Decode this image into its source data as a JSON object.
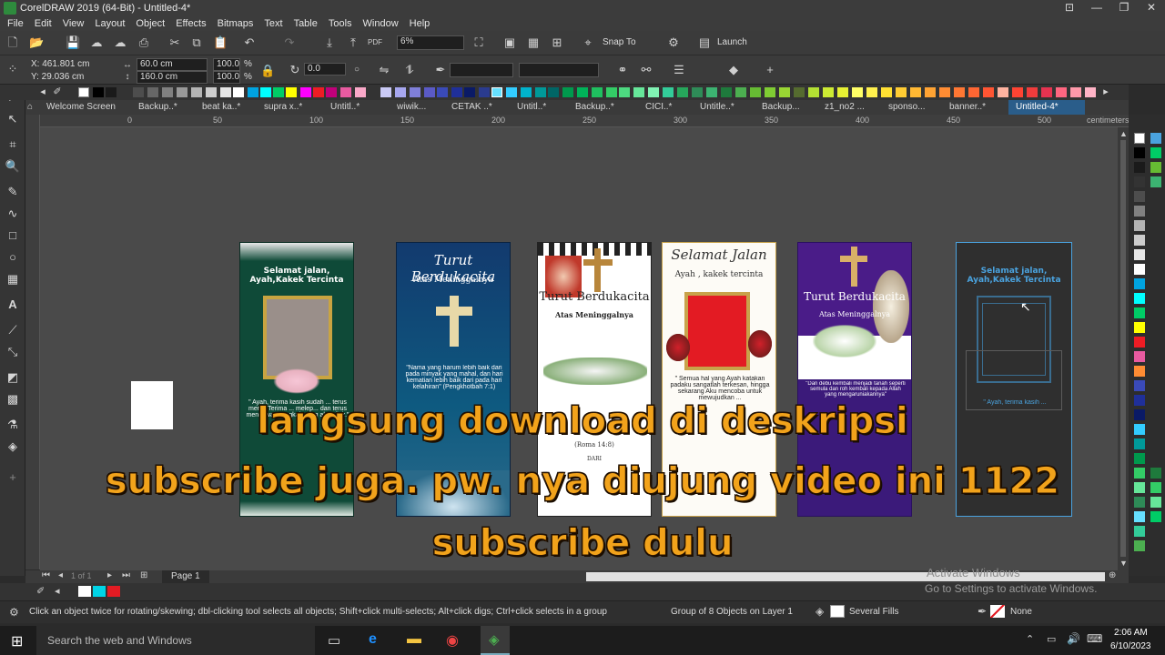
{
  "window": {
    "title": "CorelDRAW 2019 (64-Bit) - Untitled-4*",
    "controls": [
      "⊡",
      "—",
      "❐",
      "✕"
    ]
  },
  "menu": [
    "File",
    "Edit",
    "View",
    "Layout",
    "Object",
    "Effects",
    "Bitmaps",
    "Text",
    "Table",
    "Tools",
    "Window",
    "Help"
  ],
  "toolbar": {
    "zoom": "6%",
    "snap_to": "Snap To",
    "launch": "Launch"
  },
  "propertybar": {
    "x": "X: 461.801 cm",
    "y": "Y: 29.036 cm",
    "w": "60.0 cm",
    "h": "160.0 cm",
    "sx": "100.0",
    "sy": "100.0",
    "sx_unit": "%",
    "sy_unit": "%",
    "angle": "0.0"
  },
  "doc_tabs": [
    "Welcome Screen",
    "Backup..*",
    "beat ka..*",
    "supra x..*",
    "Untitl..*",
    "wiwik...",
    "CETAK ..*",
    "Untitl..*",
    "Backup..*",
    "CICI..*",
    "Untitle..*",
    "Backup...",
    "z1_no2 ...",
    "sponso...",
    "banner..*",
    "Untitled-4*"
  ],
  "ruler_unit": "centimeters",
  "ruler_h_ticks": [
    "0",
    "50",
    "100",
    "150",
    "200",
    "250",
    "300",
    "350",
    "400",
    "450",
    "500"
  ],
  "banners": [
    {
      "title": "Selamat jalan,\nAyah,Kakek Tercinta",
      "quote": "\" Ayah, terima kasih sudah ... terus men... Terima ... melep... dan terus mengawasi langkah yang aku pijak.\""
    },
    {
      "title": "Turut Berdukacita",
      "subtitle": "Atas Meninggalnya",
      "quote": "\"Nama yang harum lebih baik dari pada minyak yang mahal, dan hari kematian lebih baik dari pada hari kelahiran\" (Pengkhotbah 7:1)"
    },
    {
      "title": "Turut Berdukacita",
      "subtitle": "Atas Meninggalnya",
      "verse": "(Roma 14:8)",
      "from": "DARI"
    },
    {
      "title": "Selamat Jalan",
      "subtitle": "Ayah , kakek tercinta",
      "quote": "\" Semua hal yang Ayah katakan padaku sangatlah terkesan, hingga sekarang Aku mencoba untuk mewujudkan ..."
    },
    {
      "title": "Turut Berdukacita",
      "subtitle": "Atas Meninggalnya",
      "quote": "\"Dan debu kembali menjadi tanah seperti semula dan roh kembali kepada Allah yang mengaruniakannya\""
    },
    {
      "title": "Selamat jalan, Ayah,Kakek Tercinta",
      "quote": "\" Ayah, terima kasih ..."
    }
  ],
  "overlay": {
    "line1": "langsung download di deskripsi",
    "line2": "subscribe juga. pw. nya diujung video ini 1122",
    "line3": "subscribe dulu"
  },
  "pagebar": {
    "nav": "1 of 1",
    "page": "Page 1"
  },
  "status": {
    "hint": "Click an object twice for rotating/skewing; dbl-clicking tool selects all objects; Shift+click multi-selects; Alt+click digs; Ctrl+click selects in a group",
    "selection": "Group of 8 Objects on Layer 1",
    "fill": "Several Fills",
    "outline": "None"
  },
  "watermark": {
    "line1": "Activate Windows",
    "line2": "Go to Settings to activate Windows."
  },
  "taskbar": {
    "search": "Search the web and Windows",
    "time": "2:06 AM",
    "date": "6/10/2023"
  },
  "colors": {
    "ui_dark": "#3b3b3b",
    "canvas": "#4a4a4a",
    "overlay_text": "#f2a31b",
    "selection_blue": "#4aa3df"
  }
}
